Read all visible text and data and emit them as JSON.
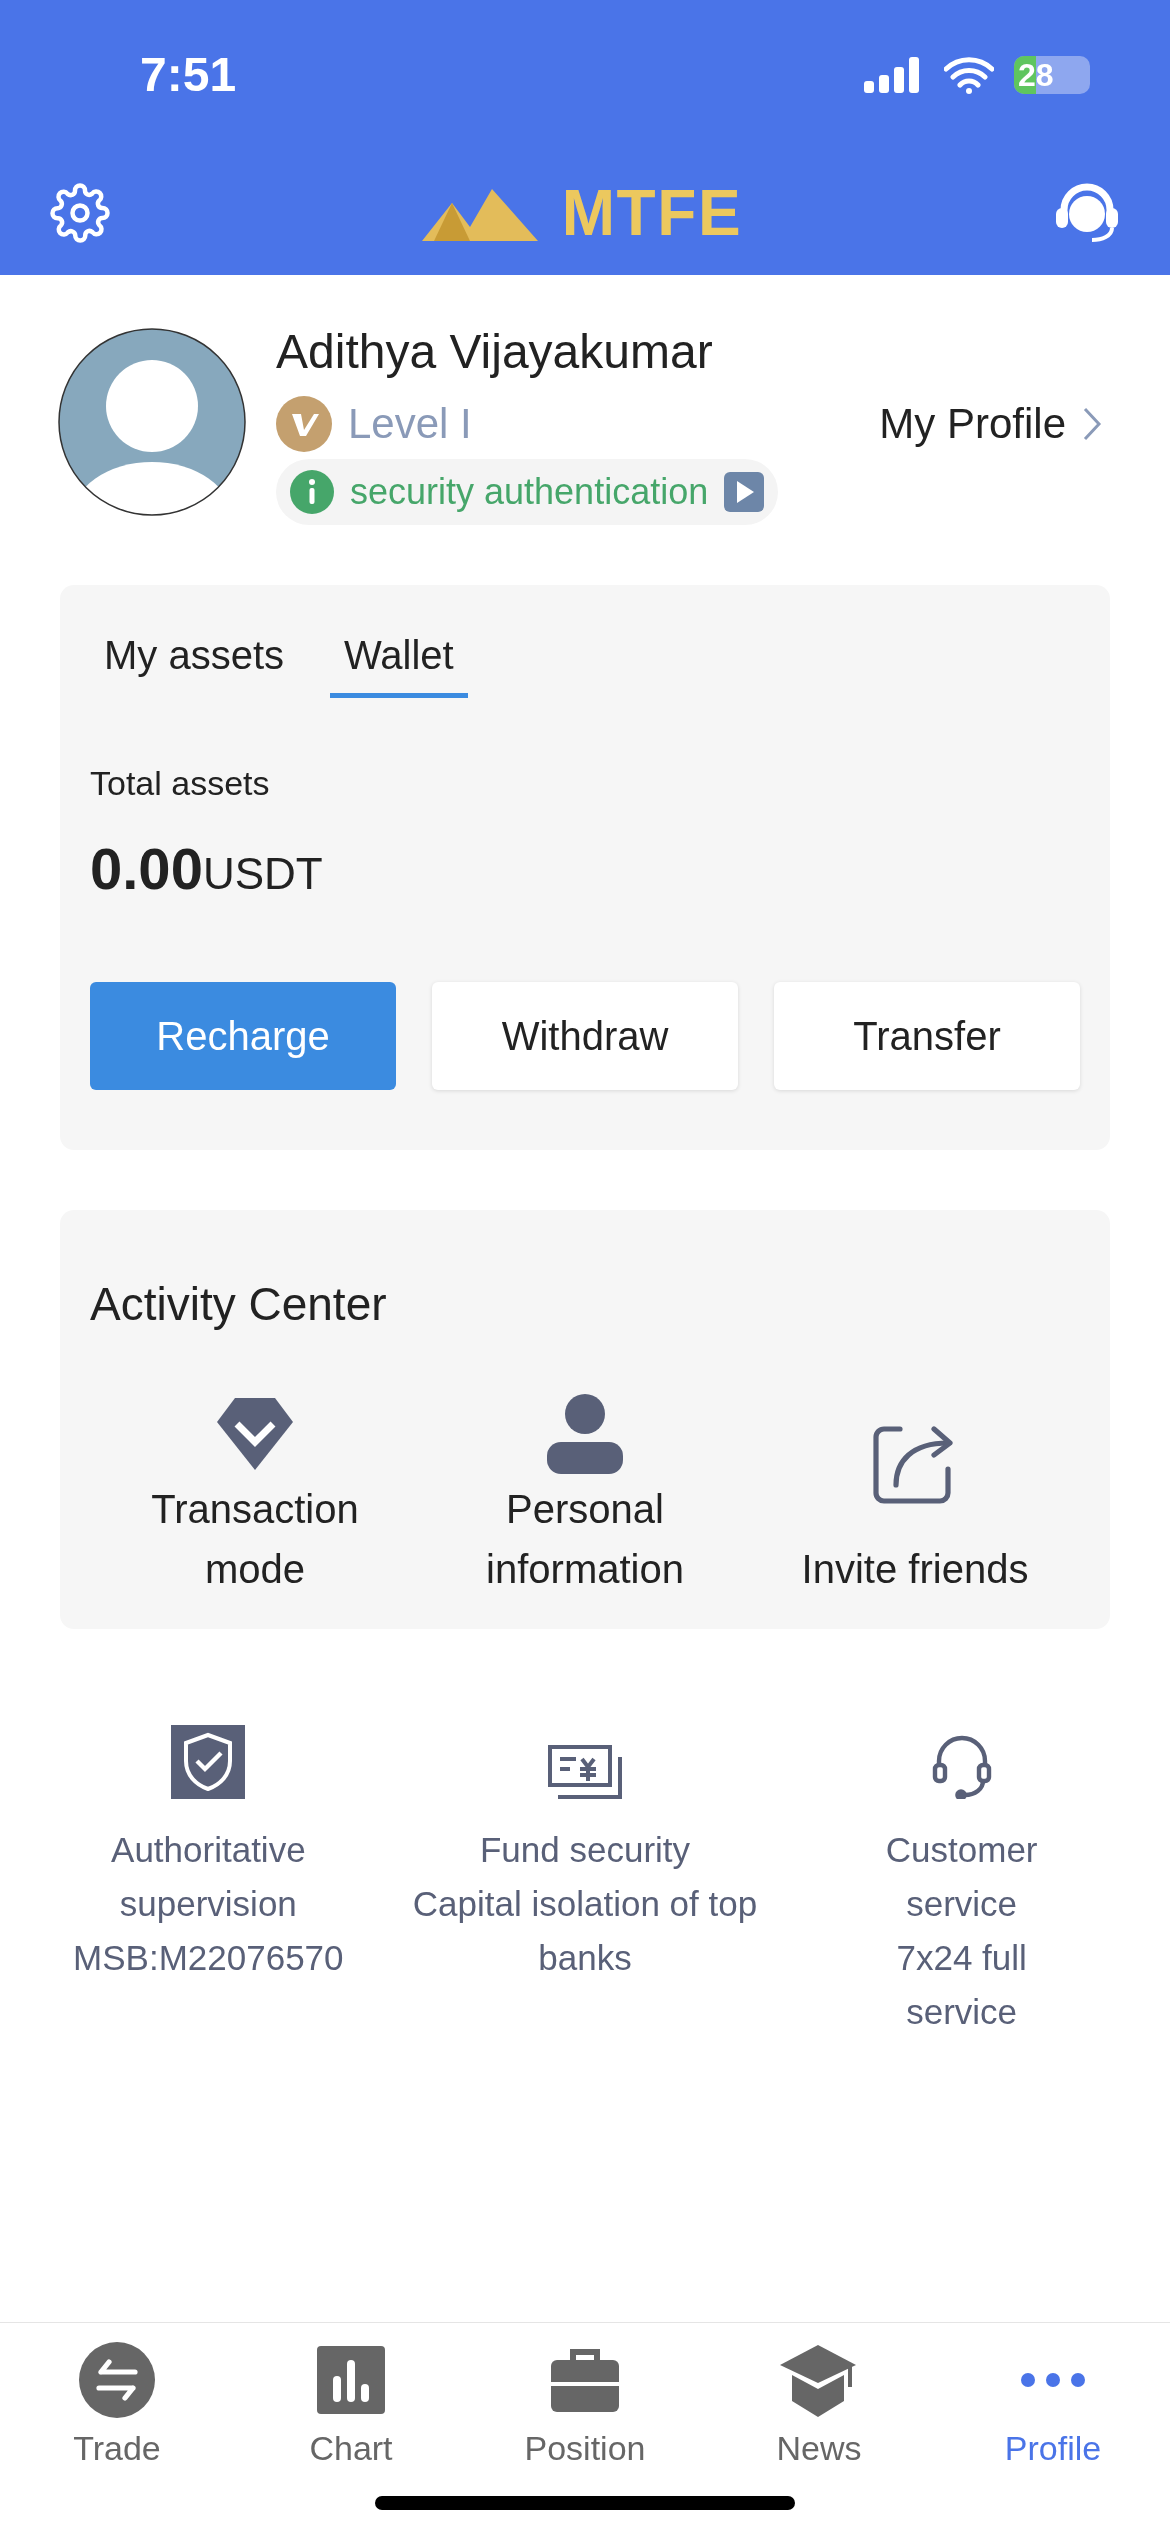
{
  "status_bar": {
    "time": "7:51",
    "battery": "28"
  },
  "header": {
    "logo": "MTFE"
  },
  "profile": {
    "name": "Adithya Vijayakumar",
    "level": "Level I",
    "security": "security authentication",
    "link": "My Profile"
  },
  "assets": {
    "tabs": [
      {
        "label": "My assets",
        "selected": false
      },
      {
        "label": "Wallet",
        "selected": true
      }
    ],
    "total_label": "Total assets",
    "amount": "0.00",
    "unit": "USDT",
    "buttons": [
      {
        "label": "Recharge",
        "primary": true
      },
      {
        "label": "Withdraw",
        "primary": false
      },
      {
        "label": "Transfer",
        "primary": false
      }
    ]
  },
  "activity": {
    "title": "Activity Center",
    "items": [
      {
        "label": "Transaction mode"
      },
      {
        "label": "Personal information"
      },
      {
        "label": "Invite friends"
      }
    ]
  },
  "features": [
    {
      "title": "Authoritative supervision",
      "detail": "MSB:M22076570"
    },
    {
      "title": "Fund security",
      "detail": "Capital isolation of top banks"
    },
    {
      "title": "Customer service",
      "detail": "7x24 full service"
    }
  ],
  "nav": [
    {
      "label": "Trade",
      "selected": false
    },
    {
      "label": "Chart",
      "selected": false
    },
    {
      "label": "Position",
      "selected": false
    },
    {
      "label": "News",
      "selected": false
    },
    {
      "label": "Profile",
      "selected": true
    }
  ]
}
